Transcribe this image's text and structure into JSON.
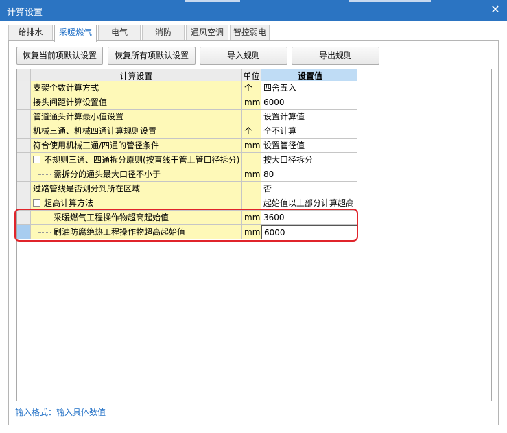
{
  "window": {
    "title": "计算设置",
    "close_icon": "close-icon",
    "accent_color": "#2b74c2"
  },
  "tabs": [
    {
      "label": "给排水",
      "active": false
    },
    {
      "label": "采暖燃气",
      "active": true
    },
    {
      "label": "电气",
      "active": false
    },
    {
      "label": "消防",
      "active": false
    },
    {
      "label": "通风空调",
      "active": false
    },
    {
      "label": "智控弱电",
      "active": false
    }
  ],
  "toolbar": {
    "restore_current_label": "恢复当前项默认设置",
    "restore_all_label": "恢复所有项默认设置",
    "import_label": "导入规则",
    "export_label": "导出规则"
  },
  "table": {
    "headers": {
      "setting": "计算设置",
      "unit": "单位",
      "value": "设置值"
    },
    "rows": [
      {
        "name": "支架个数计算方式",
        "unit": "个",
        "value": "四舍五入"
      },
      {
        "name": "接头间距计算设置值",
        "unit": "mm",
        "value": "6000"
      },
      {
        "name": "管道通头计算最小值设置",
        "unit": "",
        "value": "设置计算值"
      },
      {
        "name": "机械三通、机械四通计算规则设置",
        "unit": "个",
        "value": "全不计算"
      },
      {
        "name": "符合使用机械三通/四通的管径条件",
        "unit": "mm",
        "value": "设置管径值"
      },
      {
        "name": "不规则三通、四通拆分原则(按直线干管上管口径拆分)",
        "unit": "",
        "value": "按大口径拆分",
        "toggle": "−"
      },
      {
        "name": "需拆分的通头最大口径不小于",
        "unit": "mm",
        "value": "80",
        "child": true
      },
      {
        "name": "过路管线是否划分到所在区域",
        "unit": "",
        "value": "否"
      },
      {
        "name": "超高计算方法",
        "unit": "",
        "value": "起始值以上部分计算超高",
        "toggle": "−"
      },
      {
        "name": "采暖燃气工程操作物超高起始值",
        "unit": "mm",
        "value": "3600",
        "child": true
      },
      {
        "name": "刷油防腐绝热工程操作物超高起始值",
        "unit": "mm",
        "value": "6000",
        "child": true,
        "selected": true
      }
    ]
  },
  "status": {
    "hint": "输入格式：输入具体数值"
  },
  "highlight_color": "#e0242b"
}
